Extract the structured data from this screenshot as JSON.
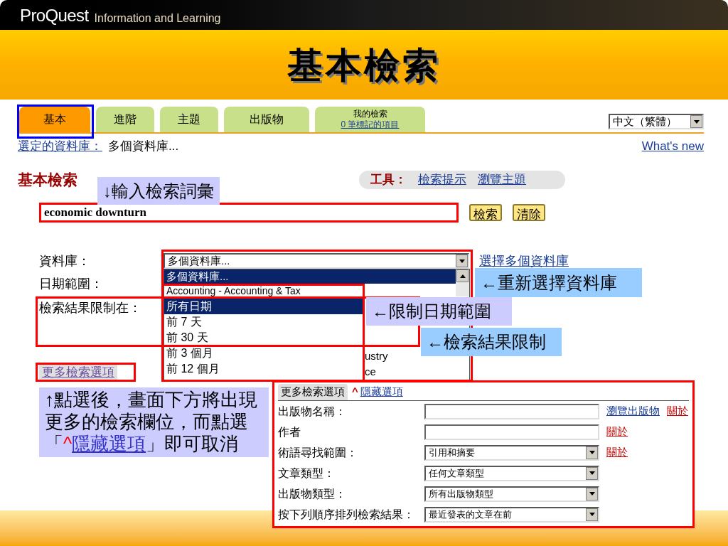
{
  "header": {
    "logo": "ProQuest",
    "tagline": "Information and Learning"
  },
  "slide_title": "基本檢索",
  "tabs": [
    {
      "label": "基本",
      "selected": true
    },
    {
      "label": "進階",
      "selected": false
    },
    {
      "label": "主題",
      "selected": false
    },
    {
      "label": "出版物",
      "selected": false
    },
    {
      "label": "我的檢索",
      "sublabel": "0 筆標記的項目",
      "selected": false
    }
  ],
  "language_select": {
    "value": "中文（繁體）"
  },
  "selected_db": {
    "label": "選定的資料庫：",
    "value": "多個資料庫..."
  },
  "whats_new": "What's new",
  "heading": "基本檢索",
  "tools": {
    "label": "工具：",
    "links": [
      "檢索提示",
      "瀏覽主題"
    ]
  },
  "search": {
    "value": "economic downturn",
    "buttons": [
      "檢索",
      "清除"
    ]
  },
  "form": {
    "database": {
      "label": "資料庫：",
      "value": "多個資料庫...",
      "link": "選擇多個資料庫",
      "options": [
        {
          "text": "多個資料庫...",
          "selected": true
        },
        {
          "text": "Accounting - Accounting & Tax",
          "selected": false
        }
      ],
      "option_fragments": [
        "ustry",
        "ce"
      ]
    },
    "date_range": {
      "label": "日期範圍：",
      "options": [
        {
          "text": "所有日期",
          "selected": true
        },
        {
          "text": "前 7 天",
          "selected": false
        },
        {
          "text": "前 30 天",
          "selected": false
        },
        {
          "text": "前 3 個月",
          "selected": false
        },
        {
          "text": "前 12 個月",
          "selected": false
        }
      ]
    },
    "limit": {
      "label": "檢索結果限制在："
    },
    "more_options_link": "更多檢索選項"
  },
  "more_options": {
    "tab": "更多檢索選項",
    "caret": "^",
    "hide_link": "隱藏選項",
    "rows": [
      {
        "kind": "text",
        "label": "出版物名稱：",
        "links": [
          {
            "kind": "browse",
            "text": "瀏覽出版物"
          },
          {
            "kind": "about",
            "text": "關於"
          }
        ]
      },
      {
        "kind": "text",
        "label": "作者",
        "links": [
          {
            "kind": "about",
            "text": "關於"
          }
        ]
      },
      {
        "kind": "select",
        "label": "術語尋找範圍：",
        "value": "引用和摘要",
        "links": [
          {
            "kind": "about",
            "text": "關於"
          }
        ]
      },
      {
        "kind": "select",
        "label": "文章類型：",
        "value": "任何文章類型"
      },
      {
        "kind": "select",
        "label": "出版物類型：",
        "value": "所有出版物類型"
      },
      {
        "kind": "select",
        "label": "按下列順序排列檢索結果：",
        "value": "最近發表的文章在前"
      }
    ]
  },
  "annotations": [
    {
      "text": "↓輸入檢索詞彙",
      "color": "#ccccff"
    },
    {
      "text": "←重新選擇資料庫",
      "color": "#99ccff"
    },
    {
      "text": "←限制日期範圍",
      "color": "#ccccff"
    },
    {
      "text": "←檢索結果限制",
      "color": "#99ccff"
    }
  ],
  "note": {
    "before": "↑點選後，畫面下方將出現更多的檢索欄位，而點選「",
    "caret": "^",
    "link": "隱藏選項",
    "after": "」即可取消",
    "color": "#ccccff"
  }
}
